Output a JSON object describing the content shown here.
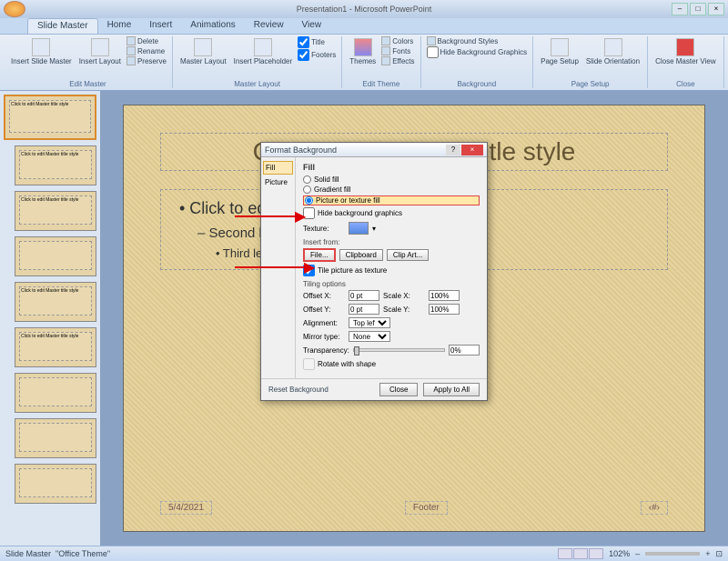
{
  "window": {
    "title": "Presentation1 - Microsoft PowerPoint"
  },
  "tabs": {
    "slide_master": "Slide Master",
    "home": "Home",
    "insert": "Insert",
    "animations": "Animations",
    "review": "Review",
    "view": "View"
  },
  "ribbon": {
    "edit_master": {
      "insert_slide_master": "Insert Slide\nMaster",
      "insert_layout": "Insert\nLayout",
      "delete": "Delete",
      "rename": "Rename",
      "preserve": "Preserve",
      "title": "Edit Master"
    },
    "master_layout": {
      "master_layout": "Master\nLayout",
      "insert_placeholder": "Insert\nPlaceholder",
      "title_chk": "Title",
      "footers_chk": "Footers",
      "title": "Master Layout"
    },
    "edit_theme": {
      "themes": "Themes",
      "colors": "Colors",
      "fonts": "Fonts",
      "effects": "Effects",
      "title": "Edit Theme"
    },
    "background": {
      "bg_styles": "Background Styles",
      "hide_bg": "Hide Background Graphics",
      "title": "Background"
    },
    "page_setup": {
      "page_setup": "Page\nSetup",
      "orientation": "Slide\nOrientation",
      "title": "Page Setup"
    },
    "close": {
      "close": "Close\nMaster View",
      "title": "Close"
    }
  },
  "slide": {
    "title": "Click to edit Master title style",
    "b1": "• Click to edit Master text styles",
    "b2": "– Second level",
    "b3": "• Third level",
    "date": "5/4/2021",
    "footer": "Footer",
    "num": "‹#›"
  },
  "thumbs": {
    "t1": "Click to edit Master title style",
    "t2": "Click to edit Master title style",
    "t3": "Click to edit Master title style",
    "t5": "Click to edit Master title style",
    "t6": "Click to edit Master title style"
  },
  "dialog": {
    "title": "Format Background",
    "side_fill": "Fill",
    "side_picture": "Picture",
    "section": "Fill",
    "solid": "Solid fill",
    "gradient": "Gradient fill",
    "pictex": "Picture or texture fill",
    "hidebg": "Hide background graphics",
    "texture": "Texture:",
    "insert_from": "Insert from:",
    "file": "File...",
    "clipboard": "Clipboard",
    "clipart": "Clip Art...",
    "tile": "Tile picture as texture",
    "tiling": "Tiling options",
    "offx": "Offset X:",
    "offx_v": "0 pt",
    "sx": "Scale X:",
    "sx_v": "100%",
    "offy": "Offset Y:",
    "offy_v": "0 pt",
    "sy": "Scale Y:",
    "sy_v": "100%",
    "align": "Alignment:",
    "align_v": "Top left",
    "mirror": "Mirror type:",
    "mirror_v": "None",
    "trans": "Transparency:",
    "trans_v": "0%",
    "rotate": "Rotate with shape",
    "reset": "Reset Background",
    "close": "Close",
    "apply": "Apply to All"
  },
  "status": {
    "left1": "Slide Master",
    "left2": "\"Office Theme\"",
    "zoom": "102%"
  }
}
